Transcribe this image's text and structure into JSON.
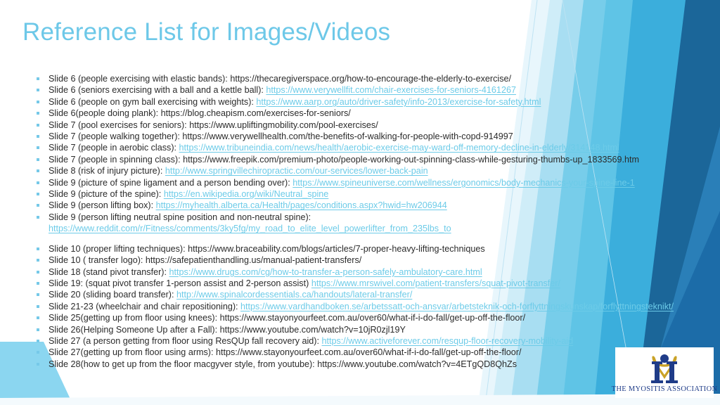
{
  "slide": {
    "title": "Reference List for Images/Videos",
    "title_color": "#6DC8E8",
    "link_color": "#6CCBE8",
    "text_color": "#2b2b2b",
    "background_color": "#ffffff"
  },
  "references": [
    {
      "label": "Slide 6 (people exercising with elastic bands): ",
      "url": "https://thecaregiverspace.org/how-to-encourage-the-elderly-to-exercise/",
      "linked": false
    },
    {
      "label": "Slide 6 (seniors exercising with a ball and a  kettle ball): ",
      "url": "https://www.verywellfit.com/chair-exercises-for-seniors-4161267",
      "linked": true
    },
    {
      "label": "Slide 6 (people on gym ball exercising with weights): ",
      "url": "https://www.aarp.org/auto/driver-safety/info-2013/exercise-for-safety.html",
      "linked": true
    },
    {
      "label": "Slide 6(people doing plank): ",
      "url": "https://blog.cheapism.com/exercises-for-seniors/",
      "linked": false
    },
    {
      "label": "Slide 7 (pool exercises for seniors): ",
      "url": "https://www.upliftingmobility.com/pool-exercises/",
      "linked": false
    },
    {
      "label": "Slide 7 (people walking together): ",
      "url": "https://www.verywellhealth.com/the-benefits-of-walking-for-people-with-copd-914997",
      "linked": false
    },
    {
      "label": "Slide 7 (people in aerobic class): ",
      "url": "https://www.tribuneindia.com/news/health/aerobic-exercise-may-ward-off-memory-decline-in-elderly/314148.html",
      "linked": true
    },
    {
      "label": "Slide 7 (people in spinning class): ",
      "url": "https://www.freepik.com/premium-photo/people-working-out-spinning-class-while-gesturing-thumbs-up_1833569.htm",
      "linked": false
    },
    {
      "label": "Slide 8 (risk of injury picture): ",
      "url": "http://www.springvillechiropractic.com/our-services/lower-back-pain",
      "linked": true
    },
    {
      "label": "Slide 9 (picture of spine ligament and a person bending over): ",
      "url": "https://www.spineuniverse.com/wellness/ergonomics/body-mechanics-your-spine-line-1",
      "linked": true
    },
    {
      "label": "Slide 9 (picture of the spine): ",
      "url": "https://en.wikipedia.org/wiki/Neutral_spine",
      "linked": true
    },
    {
      "label": "Slide 9 (person lifting box): ",
      "url": "https://myhealth.alberta.ca/Health/pages/conditions.aspx?hwid=hw206944",
      "linked": true
    }
  ],
  "wrapped_reference": {
    "label": "Slide 9 (person lifting neutral spine position and non-neutral spine):",
    "url": "https://www.reddit.com/r/Fitness/comments/3ky5fg/my_road_to_elite_level_powerlifter_from_235lbs_to",
    "linked": true
  },
  "references_tail": [
    {
      "label": "Slide 10 (proper lifting techniques): ",
      "url": "https://www.braceability.com/blogs/articles/7-proper-heavy-lifting-techniques",
      "linked": false
    },
    {
      "label": "Slide 10 ( transfer logo): ",
      "url": "https://safepatienthandling.us/manual-patient-transfers/",
      "linked": false
    },
    {
      "label": "Slide 18 (stand pivot transfer): ",
      "url": "https://www.drugs.com/cg/how-to-transfer-a-person-safely-ambulatory-care.html",
      "linked": true
    },
    {
      "label": "Slide 19: (squat pivot transfer 1-person assist and 2-person assist) ",
      "url": "https://www.mrswivel.com/patient-transfers/squat-pivot-transfer/",
      "linked": true
    },
    {
      "label": "Slide 20 (sliding board transfer): ",
      "url": "http://www.spinalcordessentials.ca/handouts/lateral-transfer/",
      "linked": true
    },
    {
      "label": "Slide 21-23 (wheelchair and chair repositioning): ",
      "url": "https://www.vardhandboken.se/arbetssatt-och-ansvar/arbetsteknik-och-forflyttningskunskap/forflyttningsteknikt/",
      "linked": true
    },
    {
      "label": "Slide 25(getting up from floor using knees): ",
      "url": "https://www.stayonyourfeet.com.au/over60/what-if-i-do-fall/get-up-off-the-floor/",
      "linked": false
    },
    {
      "label": "Slide 26(Helping Someone Up after a Fall): ",
      "url": "https://www.youtube.com/watch?v=10jR0zjl19Y",
      "linked": false
    },
    {
      "label": "Slide 27 (a person getting from floor using ResQUp fall recovery aid): ",
      "url": "https://www.activeforever.com/resqup-floor-recovery-mobility-aid",
      "linked": true
    },
    {
      "label": "Slide 27(getting up from floor using arms): ",
      "url": "https://www.stayonyourfeet.com.au/over60/what-if-i-do-fall/get-up-off-the-floor/",
      "linked": false
    },
    {
      "label": "Slide 28(how to get up from the floor macgyver style,  from youtube): ",
      "url": "https://www.youtube.com/watch?v=4ETgQD8QhZs",
      "linked": false
    }
  ],
  "logo": {
    "text": "The Myositis Association",
    "mark_color_navy": "#1F3C88",
    "mark_color_gold": "#C9A227"
  }
}
